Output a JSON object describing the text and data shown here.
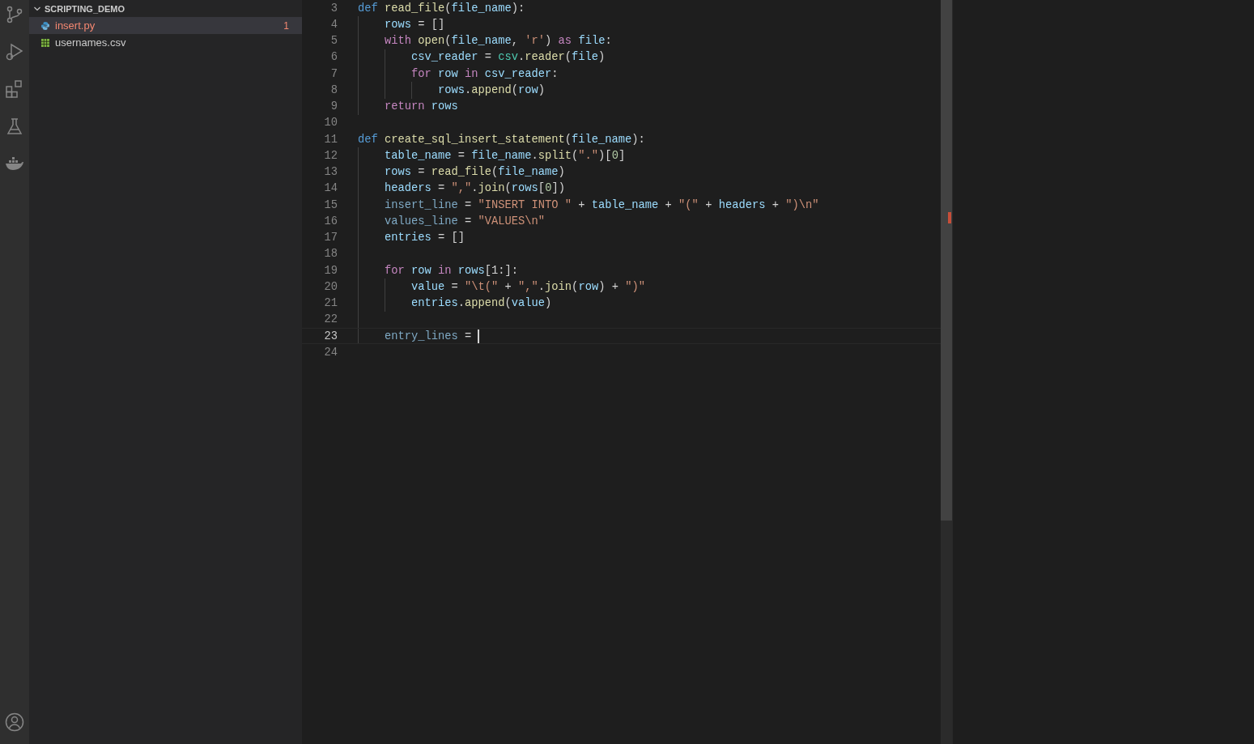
{
  "explorer": {
    "folder": "SCRIPTING_DEMO",
    "expanded": true,
    "files": [
      {
        "name": "insert.py",
        "kind": "python",
        "selected": true,
        "error": true,
        "problems": "1"
      },
      {
        "name": "usernames.csv",
        "kind": "csv",
        "selected": false,
        "error": false
      }
    ]
  },
  "editor": {
    "lines": [
      {
        "number": "3",
        "current": false,
        "tokens": [
          {
            "text": "def ",
            "kind": "kw"
          },
          {
            "text": "read_file",
            "kind": "fn"
          },
          {
            "text": "(",
            "kind": "p"
          },
          {
            "text": "file_name",
            "kind": "var"
          },
          {
            "text": "):",
            "kind": "p"
          }
        ],
        "children": [
          {
            "number": "4",
            "current": false,
            "tokens": [
              {
                "text": "rows",
                "kind": "var"
              },
              {
                "text": " = []",
                "kind": "p"
              }
            ]
          },
          {
            "number": "5",
            "current": false,
            "tokens": [
              {
                "text": "with ",
                "kind": "ctl"
              },
              {
                "text": "open",
                "kind": "fn"
              },
              {
                "text": "(",
                "kind": "p"
              },
              {
                "text": "file_name",
                "kind": "var"
              },
              {
                "text": ", ",
                "kind": "p"
              },
              {
                "text": "'r'",
                "kind": "str"
              },
              {
                "text": ") ",
                "kind": "p"
              },
              {
                "text": "as ",
                "kind": "ctl"
              },
              {
                "text": "file",
                "kind": "var"
              },
              {
                "text": ":",
                "kind": "p"
              }
            ],
            "children": [
              {
                "number": "6",
                "current": false,
                "tokens": [
                  {
                    "text": "csv_reader",
                    "kind": "var"
                  },
                  {
                    "text": " = ",
                    "kind": "p"
                  },
                  {
                    "text": "csv",
                    "kind": "cls"
                  },
                  {
                    "text": ".",
                    "kind": "p"
                  },
                  {
                    "text": "reader",
                    "kind": "fn"
                  },
                  {
                    "text": "(",
                    "kind": "p"
                  },
                  {
                    "text": "file",
                    "kind": "var"
                  },
                  {
                    "text": ")",
                    "kind": "p"
                  }
                ]
              },
              {
                "number": "7",
                "current": false,
                "tokens": [
                  {
                    "text": "for ",
                    "kind": "ctl"
                  },
                  {
                    "text": "row ",
                    "kind": "var"
                  },
                  {
                    "text": "in ",
                    "kind": "ctl"
                  },
                  {
                    "text": "csv_reader",
                    "kind": "var"
                  },
                  {
                    "text": ":",
                    "kind": "p"
                  }
                ],
                "children": [
                  {
                    "number": "8",
                    "current": false,
                    "tokens": [
                      {
                        "text": "rows",
                        "kind": "var"
                      },
                      {
                        "text": ".",
                        "kind": "p"
                      },
                      {
                        "text": "append",
                        "kind": "fn"
                      },
                      {
                        "text": "(",
                        "kind": "p"
                      },
                      {
                        "text": "row",
                        "kind": "var"
                      },
                      {
                        "text": ")",
                        "kind": "p"
                      }
                    ]
                  }
                ]
              }
            ]
          },
          {
            "number": "9",
            "current": false,
            "tokens": [
              {
                "text": "return ",
                "kind": "ctl"
              },
              {
                "text": "rows",
                "kind": "var"
              }
            ]
          }
        ]
      },
      {
        "number": "10",
        "current": false
      },
      {
        "number": "11",
        "current": false,
        "tokens": [
          {
            "text": "def ",
            "kind": "kw"
          },
          {
            "text": "create_sql_insert_statement",
            "kind": "fn"
          },
          {
            "text": "(",
            "kind": "p"
          },
          {
            "text": "file_name",
            "kind": "var"
          },
          {
            "text": "):",
            "kind": "p"
          }
        ],
        "children": [
          {
            "number": "12",
            "current": false,
            "tokens": [
              {
                "text": "table_name",
                "kind": "var"
              },
              {
                "text": " = ",
                "kind": "p"
              },
              {
                "text": "file_name",
                "kind": "var"
              },
              {
                "text": ".",
                "kind": "p"
              },
              {
                "text": "split",
                "kind": "fn"
              },
              {
                "text": "(",
                "kind": "p"
              },
              {
                "text": "\".\"",
                "kind": "str"
              },
              {
                "text": ")[",
                "kind": "p"
              },
              {
                "text": "0",
                "kind": "num"
              },
              {
                "text": "]",
                "kind": "p"
              }
            ]
          },
          {
            "number": "13",
            "current": false,
            "tokens": [
              {
                "text": "rows",
                "kind": "var"
              },
              {
                "text": " = ",
                "kind": "p"
              },
              {
                "text": "read_file",
                "kind": "fn"
              },
              {
                "text": "(",
                "kind": "p"
              },
              {
                "text": "file_name",
                "kind": "var"
              },
              {
                "text": ")",
                "kind": "p"
              }
            ]
          },
          {
            "number": "14",
            "current": false,
            "tokens": [
              {
                "text": "headers",
                "kind": "var"
              },
              {
                "text": " = ",
                "kind": "p"
              },
              {
                "text": "\",\"",
                "kind": "str"
              },
              {
                "text": ".",
                "kind": "p"
              },
              {
                "text": "join",
                "kind": "fn"
              },
              {
                "text": "(",
                "kind": "p"
              },
              {
                "text": "rows",
                "kind": "var"
              },
              {
                "text": "[",
                "kind": "p"
              },
              {
                "text": "0",
                "kind": "num"
              },
              {
                "text": "])",
                "kind": "p"
              }
            ]
          },
          {
            "number": "15",
            "current": false,
            "tokens": [
              {
                "text": "insert_line",
                "kind": "dim"
              },
              {
                "text": " = ",
                "kind": "p"
              },
              {
                "text": "\"INSERT INTO \"",
                "kind": "str"
              },
              {
                "text": " + ",
                "kind": "p"
              },
              {
                "text": "table_name",
                "kind": "var"
              },
              {
                "text": " + ",
                "kind": "p"
              },
              {
                "text": "\"(\"",
                "kind": "str"
              },
              {
                "text": " + ",
                "kind": "p"
              },
              {
                "text": "headers",
                "kind": "var"
              },
              {
                "text": " + ",
                "kind": "p"
              },
              {
                "text": "\")\\n\"",
                "kind": "str"
              }
            ]
          },
          {
            "number": "16",
            "current": false,
            "tokens": [
              {
                "text": "values_line",
                "kind": "dim"
              },
              {
                "text": " = ",
                "kind": "p"
              },
              {
                "text": "\"VALUES\\n\"",
                "kind": "str"
              }
            ]
          },
          {
            "number": "17",
            "current": false,
            "tokens": [
              {
                "text": "entries",
                "kind": "var"
              },
              {
                "text": " = []",
                "kind": "p"
              }
            ]
          },
          {
            "number": "18",
            "current": false
          },
          {
            "number": "19",
            "current": false,
            "tokens": [
              {
                "text": "for ",
                "kind": "ctl"
              },
              {
                "text": "row ",
                "kind": "var"
              },
              {
                "text": "in ",
                "kind": "ctl"
              },
              {
                "text": "rows",
                "kind": "var"
              },
              {
                "text": "[1:]:",
                "kind": "p"
              }
            ],
            "children": [
              {
                "number": "20",
                "current": false,
                "tokens": [
                  {
                    "text": "value",
                    "kind": "var"
                  },
                  {
                    "text": " = ",
                    "kind": "p"
                  },
                  {
                    "text": "\"\\t(\"",
                    "kind": "str"
                  },
                  {
                    "text": " + ",
                    "kind": "p"
                  },
                  {
                    "text": "\",\"",
                    "kind": "str"
                  },
                  {
                    "text": ".",
                    "kind": "p"
                  },
                  {
                    "text": "join",
                    "kind": "fn"
                  },
                  {
                    "text": "(",
                    "kind": "p"
                  },
                  {
                    "text": "row",
                    "kind": "var"
                  },
                  {
                    "text": ") + ",
                    "kind": "p"
                  },
                  {
                    "text": "\")\"",
                    "kind": "str"
                  }
                ]
              },
              {
                "number": "21",
                "current": false,
                "tokens": [
                  {
                    "text": "entries",
                    "kind": "var"
                  },
                  {
                    "text": ".",
                    "kind": "p"
                  },
                  {
                    "text": "append",
                    "kind": "fn"
                  },
                  {
                    "text": "(",
                    "kind": "p"
                  },
                  {
                    "text": "value",
                    "kind": "var"
                  },
                  {
                    "text": ")",
                    "kind": "p"
                  }
                ]
              }
            ]
          },
          {
            "number": "22",
            "current": false
          },
          {
            "number": "23",
            "current": true,
            "tokens": [
              {
                "text": "entry_lines",
                "kind": "dim"
              },
              {
                "text": " =",
                "kind": "p"
              }
            ]
          }
        ]
      },
      {
        "number": "24",
        "current": false
      }
    ]
  }
}
